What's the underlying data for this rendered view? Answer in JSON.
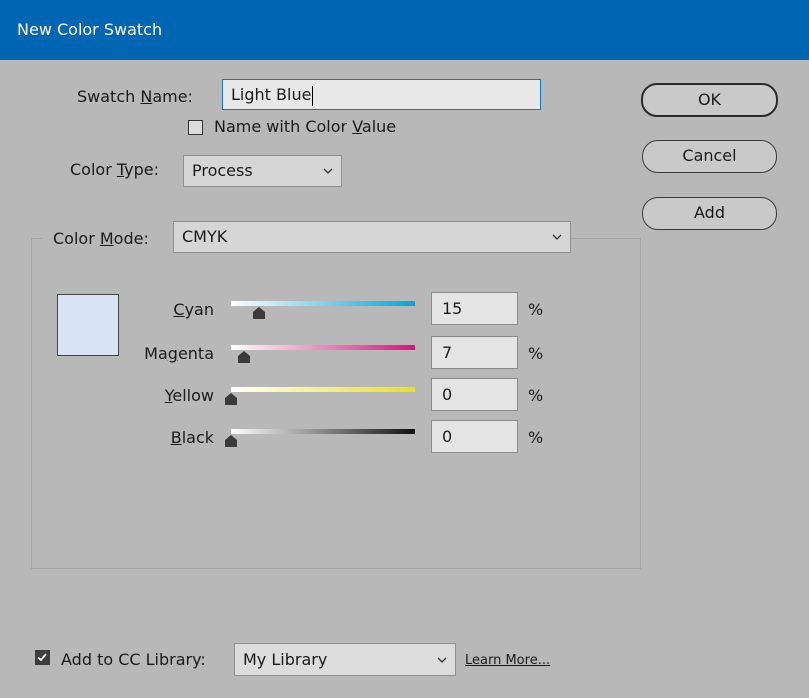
{
  "window": {
    "title": "New Color Swatch"
  },
  "swatch_name": {
    "label": "Swatch Name:",
    "label_pre": "Swatch ",
    "label_mn": "N",
    "label_post": "ame:",
    "value": "Light Blue"
  },
  "name_with_color_value": {
    "checked": false,
    "label_pre": "Name with Color ",
    "label_mn": "V",
    "label_post": "alue"
  },
  "color_type": {
    "label_pre": "Color ",
    "label_mn": "T",
    "label_post": "ype:",
    "value": "Process"
  },
  "color_mode": {
    "label_pre": "Color ",
    "label_mn": "M",
    "label_post": "ode:",
    "value": "CMYK"
  },
  "preview_color": "#d8e4f4",
  "channels": [
    {
      "label_pre": "",
      "label_mn": "C",
      "label_post": "yan",
      "value": "15",
      "unit": "%",
      "fraction": 0.15,
      "gradient_to": "#00a6dc"
    },
    {
      "label_pre": "Ma",
      "label_mn": "g",
      "label_post": "enta",
      "value": "7",
      "unit": "%",
      "fraction": 0.07,
      "gradient_to": "#d8147c"
    },
    {
      "label_pre": "",
      "label_mn": "Y",
      "label_post": "ellow",
      "value": "0",
      "unit": "%",
      "fraction": 0,
      "gradient_to": "#e8e020"
    },
    {
      "label_pre": "",
      "label_mn": "B",
      "label_post": "lack",
      "value": "0",
      "unit": "%",
      "fraction": 0,
      "gradient_to": "#101010"
    }
  ],
  "buttons": {
    "ok": "OK",
    "cancel": "Cancel",
    "add": "Add"
  },
  "cc_library": {
    "checked": true,
    "label": "Add to CC Library:",
    "value": "My Library",
    "learn_more": "Learn More..."
  },
  "colors": {
    "titlebar": "#0066b3",
    "dialog_bg": "#b8b8b8",
    "focus_border": "#1a73c9"
  }
}
